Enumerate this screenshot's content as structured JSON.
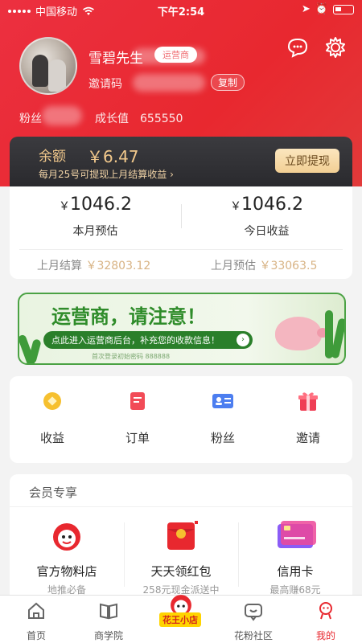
{
  "status": {
    "carrier": "中国移动",
    "time": "下午2:54"
  },
  "profile": {
    "name": "雪碧先生",
    "role_badge": "运营商",
    "invite_label": "邀请码",
    "copy_label": "复制",
    "fans_label": "粉丝",
    "growth_label": "成长值",
    "growth_value": "655550"
  },
  "balance": {
    "label": "余额",
    "value": "￥6.47",
    "note": "每月25号可提现上月结算收益",
    "withdraw_label": "立即提现"
  },
  "stats": {
    "month_value": "1046.2",
    "month_label": "本月预估",
    "today_value": "1046.2",
    "today_label": "今日收益",
    "last_settle_label": "上月结算",
    "last_settle_value": "￥32803.12",
    "last_est_label": "上月预估",
    "last_est_value": "￥33063.5",
    "currency": "￥"
  },
  "banner": {
    "title": "运营商，请注意！",
    "cta": "点此进入运营商后台，补充您的收款信息！",
    "note": "首次登录初始密码 888888"
  },
  "quick": [
    {
      "label": "收益",
      "icon": "coin-icon",
      "color": "#f6c02f"
    },
    {
      "label": "订单",
      "icon": "order-icon",
      "color": "#f24b57"
    },
    {
      "label": "粉丝",
      "icon": "contact-card-icon",
      "color": "#4c7ef0"
    },
    {
      "label": "邀请",
      "icon": "gift-icon",
      "color": "#ef3e55"
    }
  ],
  "member": {
    "title": "会员专享",
    "items": [
      {
        "title": "官方物料店",
        "sub": "地推必备"
      },
      {
        "title": "天天领红包",
        "sub": "258元现金派送中"
      },
      {
        "title": "信用卡",
        "sub": "最高赚68元"
      }
    ]
  },
  "tabs": [
    {
      "label": "首页",
      "icon": "home-icon"
    },
    {
      "label": "商学院",
      "icon": "book-icon"
    },
    {
      "label": "花王小店",
      "icon": "shop-mascot-icon"
    },
    {
      "label": "花粉社区",
      "icon": "community-icon"
    },
    {
      "label": "我的",
      "icon": "profile-icon"
    }
  ],
  "accent": "#e8282f"
}
